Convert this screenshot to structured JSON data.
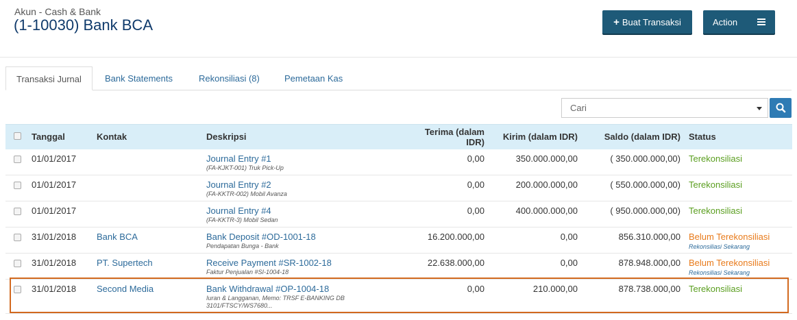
{
  "header": {
    "subtitle": "Akun - Cash & Bank",
    "title": "(1-10030) Bank BCA",
    "create_button": "Buat Transaksi",
    "create_icon": "plus-icon",
    "action_button": "Action",
    "action_icon": "hamburger-menu-icon"
  },
  "tabs": [
    {
      "label": "Transaksi Jurnal",
      "active": true
    },
    {
      "label": "Bank Statements",
      "active": false
    },
    {
      "label": "Rekonsiliasi (8)",
      "active": false
    },
    {
      "label": "Pemetaan Kas",
      "active": false
    }
  ],
  "search": {
    "placeholder": "Cari",
    "icon": "search-icon"
  },
  "table": {
    "columns": [
      "Tanggal",
      "Kontak",
      "Deskripsi",
      "Terima (dalam IDR)",
      "Kirim (dalam IDR)",
      "Saldo (dalam IDR)",
      "Status"
    ],
    "rows": [
      {
        "date": "01/01/2017",
        "contact": "",
        "desc": "Journal Entry #1",
        "desc_sub": "(FA-KJKT-001) Truk Pick-Up",
        "terima": "0,00",
        "kirim": "350.000.000,00",
        "saldo": "( 350.000.000,00)",
        "status": "Terekonsiliasi",
        "status_type": "ok",
        "status_sub": ""
      },
      {
        "date": "01/01/2017",
        "contact": "",
        "desc": "Journal Entry #2",
        "desc_sub": "(FA-KKTR-002) Mobil Avanza",
        "terima": "0,00",
        "kirim": "200.000.000,00",
        "saldo": "( 550.000.000,00)",
        "status": "Terekonsiliasi",
        "status_type": "ok",
        "status_sub": ""
      },
      {
        "date": "01/01/2017",
        "contact": "",
        "desc": "Journal Entry #4",
        "desc_sub": "(FA-KKTR-3) Mobil Sedan",
        "terima": "0,00",
        "kirim": "400.000.000,00",
        "saldo": "( 950.000.000,00)",
        "status": "Terekonsiliasi",
        "status_type": "ok",
        "status_sub": ""
      },
      {
        "date": "31/01/2018",
        "contact": "Bank BCA",
        "desc": "Bank Deposit #OD-1001-18",
        "desc_sub": "Pendapatan Bunga - Bank",
        "terima": "16.200.000,00",
        "kirim": "0,00",
        "saldo": "856.310.000,00",
        "status": "Belum Terekonsiliasi",
        "status_type": "pending",
        "status_sub": "Rekonsiliasi Sekarang"
      },
      {
        "date": "31/01/2018",
        "contact": "PT. Supertech",
        "desc": "Receive Payment #SR-1002-18",
        "desc_sub": "Faktur Penjualan #SI-1004-18",
        "terima": "22.638.000,00",
        "kirim": "0,00",
        "saldo": "878.948.000,00",
        "status": "Belum Terekonsiliasi",
        "status_type": "pending",
        "status_sub": "Rekonsiliasi Sekarang"
      },
      {
        "date": "31/01/2018",
        "contact": "Second Media",
        "desc": "Bank Withdrawal #OP-1004-18",
        "desc_sub": "Iuran & Langganan, Memo: TRSF E-BANKING DB 3101/FTSCY/WS7680...",
        "terima": "0,00",
        "kirim": "210.000,00",
        "saldo": "878.738.000,00",
        "status": "Terekonsiliasi",
        "status_type": "ok",
        "status_sub": ""
      }
    ]
  },
  "colors": {
    "primary": "#1e5a78",
    "link": "#2c6a9a",
    "ok": "#5a9e1f",
    "pending": "#e87a1a",
    "highlight": "#d2691e"
  }
}
